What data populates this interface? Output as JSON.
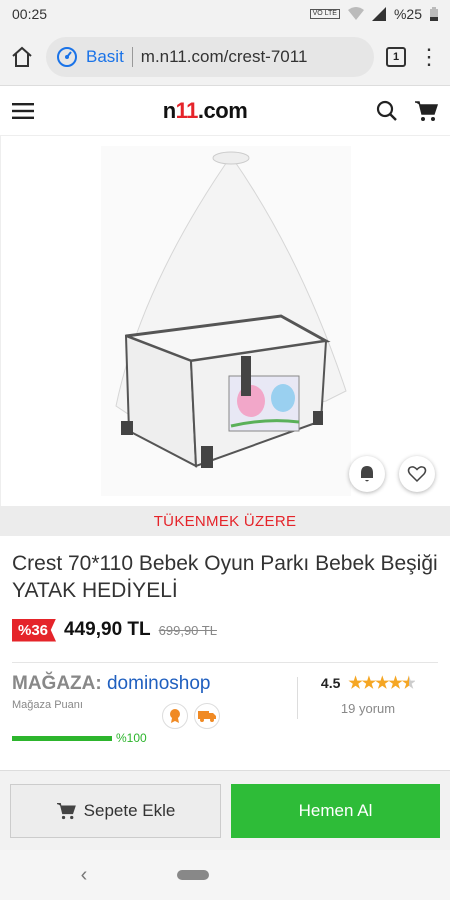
{
  "status": {
    "time": "00:25",
    "volte": "VO LTE",
    "battery": "%25"
  },
  "browser": {
    "site_label": "Basit",
    "url": "m.n11.com/crest-7011",
    "tab_count": "1"
  },
  "header": {
    "logo_prefix": "n",
    "logo_mid": "11",
    "logo_suffix": ".com"
  },
  "stock_text": "TÜKENMEK ÜZERE",
  "product": {
    "title": "Crest 70*110 Bebek Oyun Parkı Bebek Beşiği YATAK HEDİYELİ",
    "discount": "%36",
    "price": "449,90 TL",
    "old_price": "699,90 TL"
  },
  "store": {
    "label": "MAĞAZA:",
    "name": "dominoshop",
    "score_label": "Mağaza Puanı",
    "score_percent": 100,
    "score_text": "%100"
  },
  "rating": {
    "value": "4.5",
    "stars": 4.5,
    "reviews": "19 yorum"
  },
  "actions": {
    "add_to_cart": "Sepete Ekle",
    "buy_now": "Hemen Al"
  },
  "colors": {
    "brand_red": "#e5242a",
    "buy_green": "#2ebc38",
    "link_blue": "#1f5fbf",
    "star": "#f5a623"
  }
}
